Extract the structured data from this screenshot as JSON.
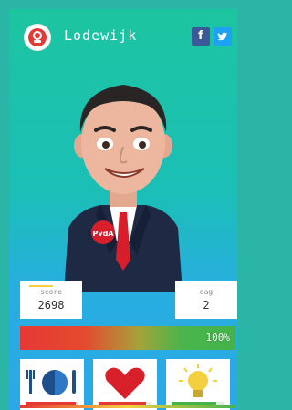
{
  "header": {
    "player_name": "Lodewijk",
    "logo_text": "PvdA",
    "social": {
      "facebook_label": "f",
      "twitter_label": "t"
    }
  },
  "avatar": {
    "badge_text": "PvdA"
  },
  "stats": {
    "score": {
      "label": "score",
      "value": "2698"
    },
    "day": {
      "label": "dag",
      "value": "2"
    }
  },
  "progress": {
    "value_text": "100%",
    "value": 100
  },
  "actions": [
    {
      "name": "food",
      "icon": "food-icon",
      "level": 0.95,
      "color": "#e53935"
    },
    {
      "name": "love",
      "icon": "heart-icon",
      "level": 0.9,
      "color": "#e53935"
    },
    {
      "name": "idea",
      "icon": "lightbulb-icon",
      "level": 0.85,
      "color": "#44b34a"
    }
  ],
  "colors": {
    "background_top": "#1cc4a0",
    "background_bottom": "#2aa8e8",
    "accent_red": "#e53935",
    "accent_green": "#44b34a"
  }
}
